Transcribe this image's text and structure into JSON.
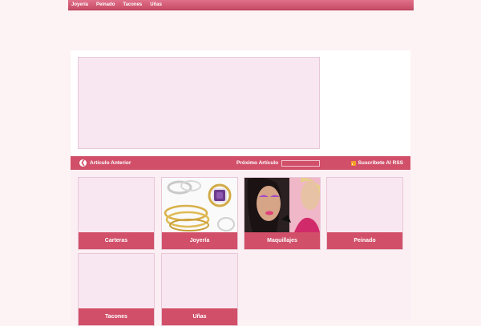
{
  "nav": {
    "items": [
      "Joyería",
      "Peinado",
      "Tacones",
      "Uñas"
    ]
  },
  "article_nav": {
    "previous_label": "Artículo Anterior",
    "next_label": "Próximo Artículo",
    "rss_label": "Suscribete Al RSS"
  },
  "categories": [
    {
      "label": "Carteras"
    },
    {
      "label": "Joyería"
    },
    {
      "label": "Maquillajes"
    },
    {
      "label": "Peinado"
    },
    {
      "label": "Tacones"
    },
    {
      "label": "Uñas"
    }
  ],
  "colors": {
    "accent": "#d14f69",
    "page_background": "#fdf2f4",
    "tile_background": "#f8e7f0",
    "rss_icon": "#f4a12a"
  },
  "icons": [
    "chevron-left-icon",
    "rss-icon"
  ]
}
